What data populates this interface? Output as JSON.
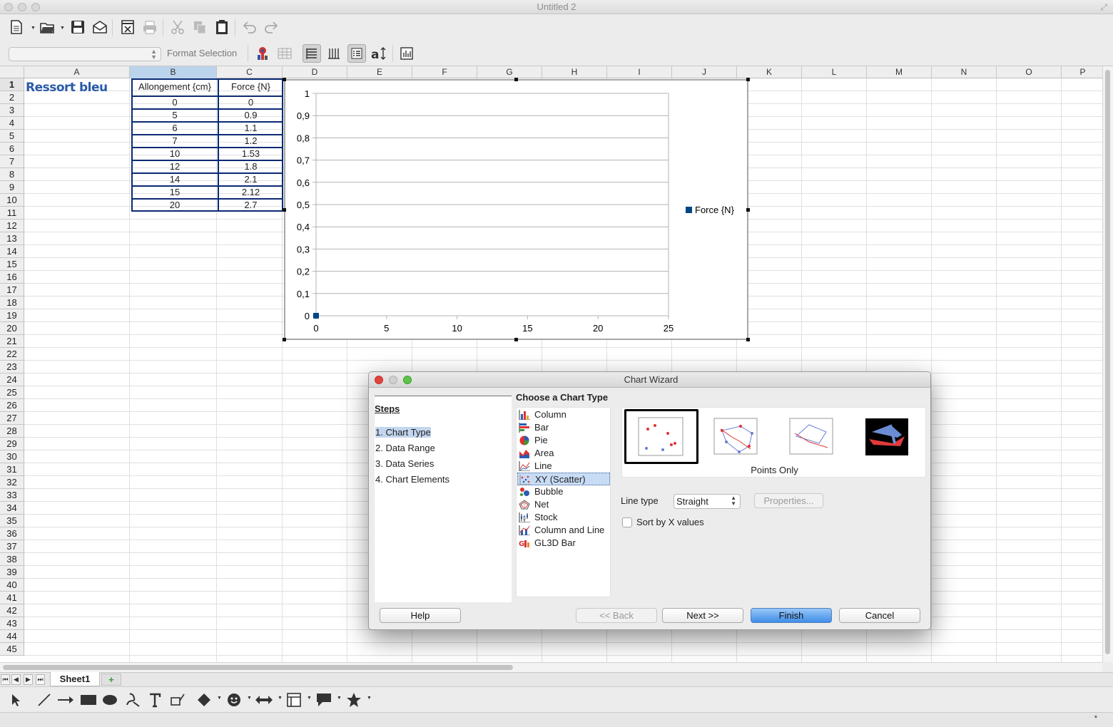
{
  "window": {
    "title": "Untitled 2"
  },
  "toolbar": {
    "format_selection": "Format Selection",
    "style_combo_value": ""
  },
  "spreadsheet": {
    "columns": [
      "A",
      "B",
      "C",
      "D",
      "E",
      "F",
      "G",
      "H",
      "I",
      "J",
      "K",
      "L",
      "M",
      "N",
      "O",
      "P"
    ],
    "rows": [
      "1",
      "2",
      "3",
      "4",
      "5",
      "6",
      "7",
      "8",
      "9",
      "10",
      "11",
      "12",
      "13",
      "14",
      "15",
      "16",
      "17",
      "18",
      "19",
      "20",
      "21",
      "22",
      "23",
      "24",
      "25",
      "26",
      "27",
      "28",
      "29",
      "30",
      "31",
      "32",
      "33",
      "34",
      "35",
      "36",
      "37",
      "38",
      "39",
      "40",
      "41",
      "42",
      "43",
      "44",
      "45"
    ],
    "a1_title": "Ressort bleu",
    "table": {
      "headers": [
        "Allongement {cm}",
        "Force {N}"
      ],
      "rows": [
        [
          "0",
          "0"
        ],
        [
          "5",
          "0.9"
        ],
        [
          "6",
          "1.1"
        ],
        [
          "7",
          "1.2"
        ],
        [
          "10",
          "1.53"
        ],
        [
          "12",
          "1.8"
        ],
        [
          "14",
          "2.1"
        ],
        [
          "15",
          "2.12"
        ],
        [
          "20",
          "2.7"
        ]
      ]
    }
  },
  "chart_data": {
    "type": "scatter",
    "title": "",
    "xlabel": "",
    "ylabel": "",
    "xlim": [
      0,
      25
    ],
    "ylim": [
      0,
      1
    ],
    "x_ticks": [
      "0",
      "5",
      "10",
      "15",
      "20",
      "25"
    ],
    "y_ticks": [
      "0",
      "0,1",
      "0,2",
      "0,3",
      "0,4",
      "0,5",
      "0,6",
      "0,7",
      "0,8",
      "0,9",
      "1"
    ],
    "series": [
      {
        "name": "Force {N}",
        "x": [
          0
        ],
        "y": [
          0
        ],
        "color": "#004586"
      }
    ],
    "legend": "right",
    "grid": true
  },
  "sheet_tabs": {
    "active": "Sheet1",
    "add": "+"
  },
  "dialog": {
    "title": "Chart Wizard",
    "steps_title": "Steps",
    "steps": [
      "1. Chart Type",
      "2. Data Range",
      "3. Data Series",
      "4. Chart Elements"
    ],
    "section_title": "Choose a Chart Type",
    "chart_types": [
      "Column",
      "Bar",
      "Pie",
      "Area",
      "Line",
      "XY (Scatter)",
      "Bubble",
      "Net",
      "Stock",
      "Column and Line",
      "GL3D Bar"
    ],
    "selected_type": "XY (Scatter)",
    "variant_label": "Points Only",
    "line_type_label": "Line type",
    "line_type_value": "Straight",
    "properties_label": "Properties...",
    "sort_label": "Sort by X values",
    "sort_checked": false,
    "buttons": {
      "help": "Help",
      "back": "<< Back",
      "next": "Next >>",
      "finish": "Finish",
      "cancel": "Cancel"
    }
  },
  "colors": {
    "accent": "#3f8de8",
    "selection": "#bcd3ec",
    "table_border": "#0b2a73",
    "series": "#004586",
    "title_blue": "#2a5aa8"
  }
}
